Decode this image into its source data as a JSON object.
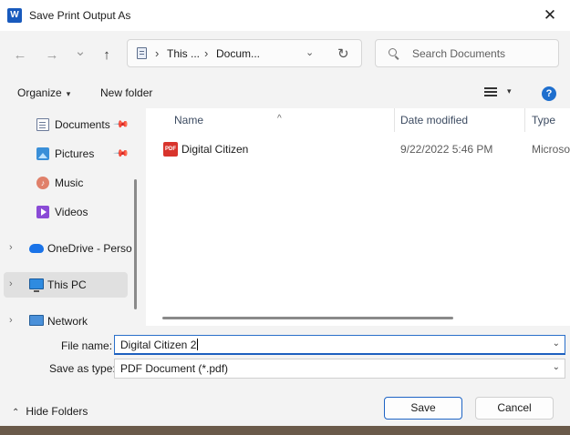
{
  "window": {
    "title": "Save Print Output As",
    "app_icon_letter": "W",
    "close_glyph": "✕"
  },
  "nav": {
    "back_glyph": "←",
    "forward_glyph": "→",
    "recent_glyph": "⌄",
    "up_glyph": "↑",
    "breadcrumbs": [
      "This ...",
      "Docum..."
    ],
    "crumb_sep": "›",
    "address_dropdown_glyph": "⌄",
    "refresh_glyph": "↻"
  },
  "search": {
    "placeholder": "Search Documents"
  },
  "toolbar": {
    "organize_label": "Organize",
    "organize_caret": "▾",
    "new_folder_label": "New folder",
    "view_caret": "▾",
    "help_glyph": "?"
  },
  "sidebar": {
    "items": [
      {
        "label": "Documents",
        "icon": "documents-icon",
        "pinned": true
      },
      {
        "label": "Pictures",
        "icon": "pictures-icon",
        "pinned": true
      },
      {
        "label": "Music",
        "icon": "music-icon"
      },
      {
        "label": "Videos",
        "icon": "videos-icon"
      },
      {
        "label": "OneDrive - Perso",
        "icon": "onedrive-icon",
        "expandable": true
      },
      {
        "label": "This PC",
        "icon": "this-pc-icon",
        "expandable": true,
        "selected": true
      },
      {
        "label": "Network",
        "icon": "network-icon",
        "expandable": true
      }
    ],
    "pin_glyph": "📌",
    "expand_glyph": "›",
    "music_glyph": "♪"
  },
  "file_list": {
    "columns": [
      "Name",
      "Date modified",
      "Type"
    ],
    "sort_glyph": "^",
    "rows": [
      {
        "name": "Digital Citizen",
        "date_modified": "9/22/2022 5:46 PM",
        "type": "Microso",
        "icon": "pdf-icon",
        "icon_text": "PDF"
      }
    ]
  },
  "form": {
    "file_name_label": "File name:",
    "file_name_value": "Digital Citizen 2",
    "save_as_type_label": "Save as type:",
    "save_as_type_value": "PDF Document (*.pdf)",
    "dropdown_glyph": "⌄"
  },
  "footer": {
    "hide_folders_label": "Hide Folders",
    "hide_glyph": "⌃",
    "save_label": "Save",
    "cancel_label": "Cancel"
  },
  "colors": {
    "accent": "#1d63c4",
    "pdf_red": "#d8342c",
    "selected_bg": "#e0e0e0",
    "help_blue": "#1f6fce"
  }
}
